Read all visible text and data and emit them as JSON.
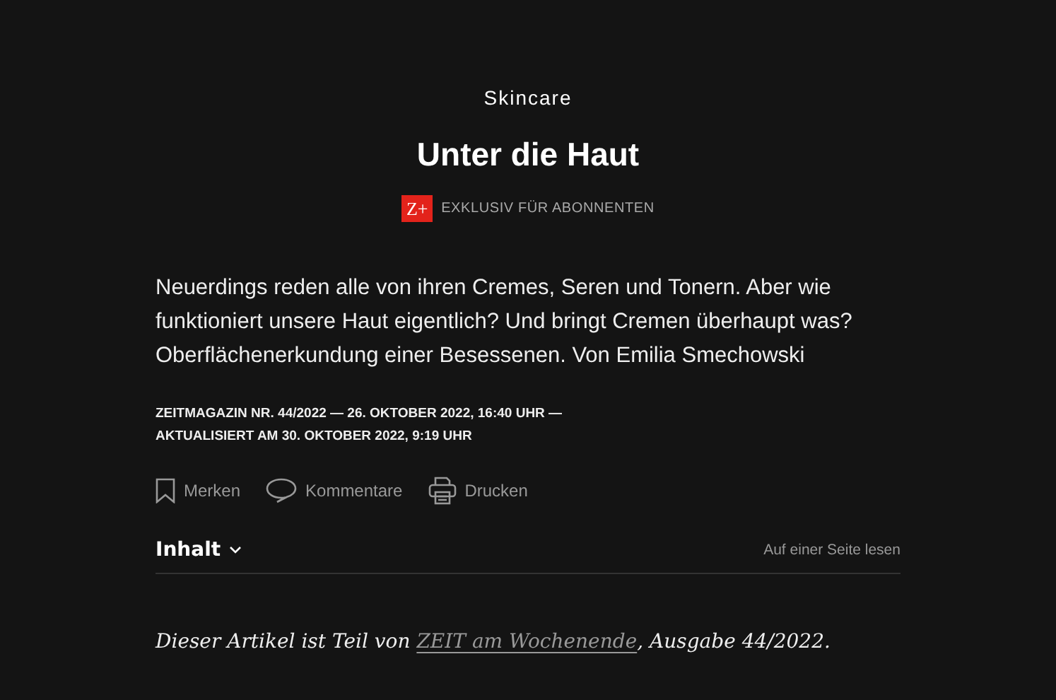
{
  "kicker": "Skincare",
  "headline": "Unter die Haut",
  "badge": {
    "logo": "Z+",
    "label": "EXKLUSIV FÜR ABONNENTEN"
  },
  "lead": "Neuerdings reden alle von ihren Cremes, Seren und Tonern. Aber wie funktioniert unsere Haut eigentlich? Und bringt Cremen überhaupt was? Oberflächenerkundung einer Besessenen. Von Emilia Smechowski",
  "meta": [
    "ZEITMAGAZIN NR. 44/2022 — 26. OKTOBER 2022, 16:40 UHR —",
    "AKTUALISIERT AM 30. OKTOBER 2022, 9:19 UHR"
  ],
  "actions": [
    {
      "kind": "bookmark",
      "label": "Merken"
    },
    {
      "kind": "comment",
      "label": "Kommentare"
    },
    {
      "kind": "print",
      "label": "Drucken"
    }
  ],
  "toc": {
    "label": "Inhalt",
    "expanded": false,
    "single_page_link": "Auf einer Seite lesen"
  },
  "intro": {
    "before": "Dieser Artikel ist Teil von ",
    "link": "ZEIT am Wochenende",
    "after": ", Ausgabe 44/2022."
  }
}
